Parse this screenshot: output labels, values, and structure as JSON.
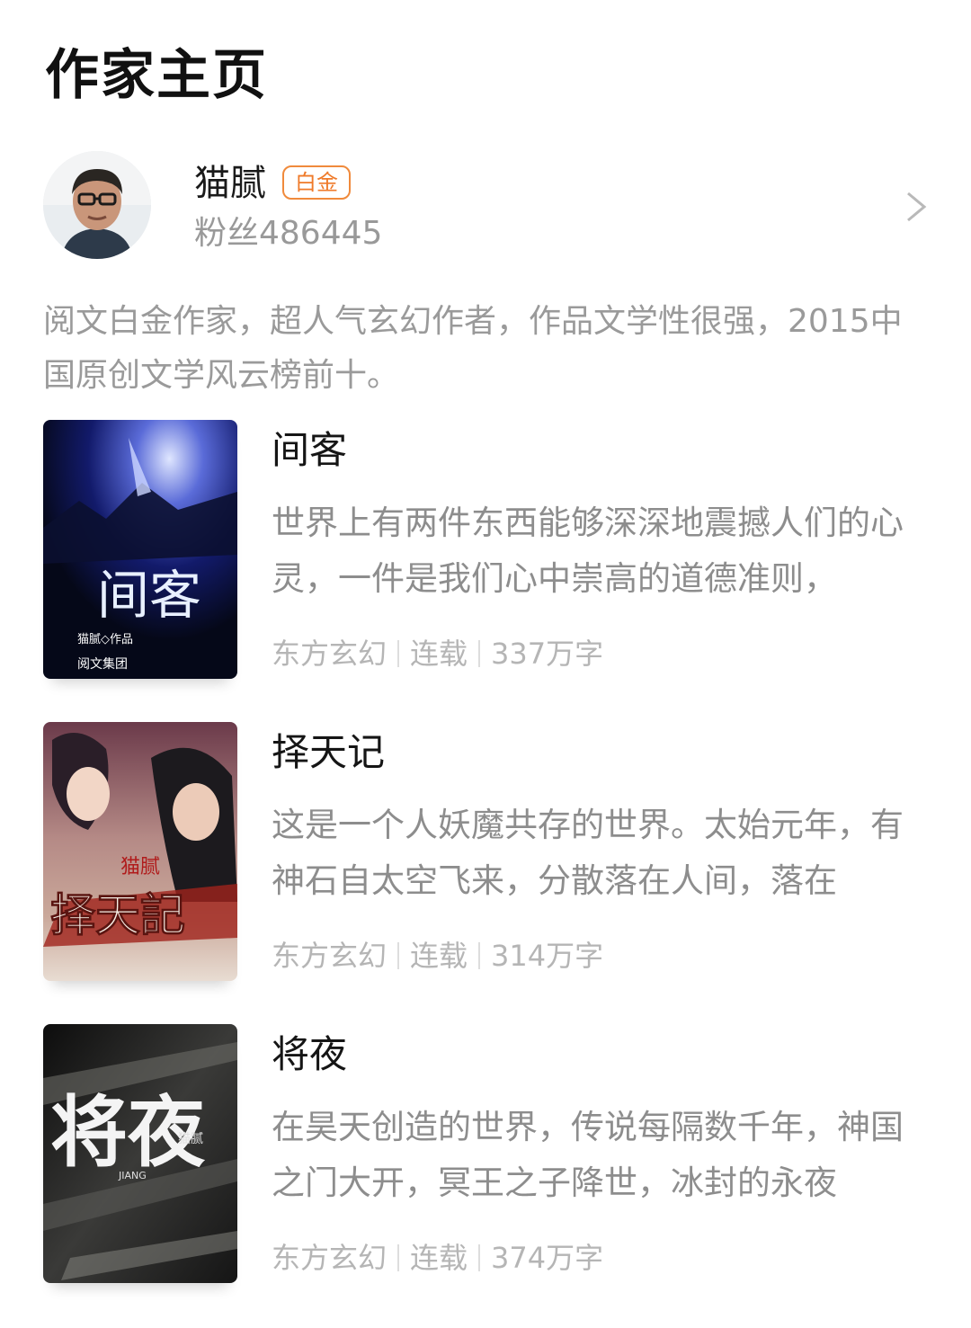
{
  "page": {
    "title": "作家主页"
  },
  "author": {
    "name": "猫腻",
    "badge": "白金",
    "fans": "粉丝486445",
    "bio": "阅文白金作家，超人气玄幻作者，作品文学性很强，2015中国原创文学风云榜前十。"
  },
  "books": [
    {
      "title": "间客",
      "description": "世界上有两件东西能够深深地震撼人们的心灵，一件是我们心中崇高的道德准则，",
      "category": "东方玄幻",
      "status": "连载",
      "words": "337万字",
      "cover_text": {
        "title": "间客",
        "author": "猫腻◇作品",
        "publisher": "阅文集团"
      }
    },
    {
      "title": "择天记",
      "description": "这是一个人妖魔共存的世界。太始元年，有神石自太空飞来，分散落在人间，落在",
      "category": "东方玄幻",
      "status": "连载",
      "words": "314万字",
      "cover_text": {
        "title": "择天記",
        "author": "猫腻"
      }
    },
    {
      "title": "将夜",
      "description": "在昊天创造的世界，传说每隔数千年，神国之门大开，冥王之子降世，冰封的永夜",
      "category": "东方玄幻",
      "status": "连载",
      "words": "374万字",
      "cover_text": {
        "title": "将夜",
        "latin": "JIANG",
        "author": "猫腻"
      }
    }
  ]
}
